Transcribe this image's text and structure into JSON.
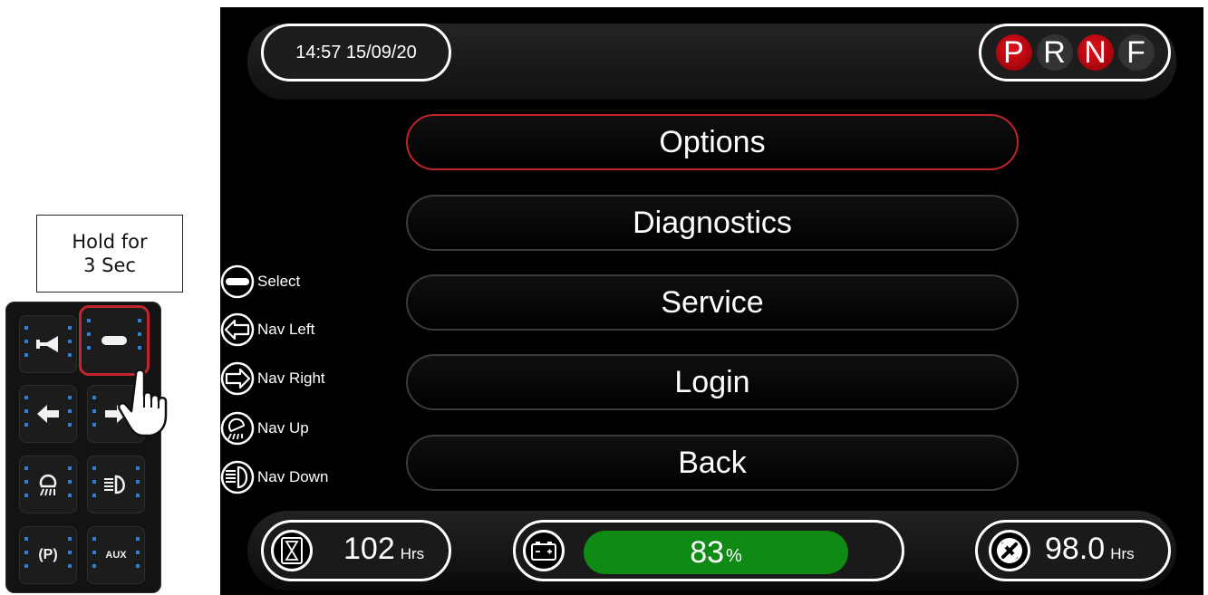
{
  "hint": {
    "line1": "Hold for",
    "line2": "3 Sec"
  },
  "keypad": {
    "aux_label": "AUX",
    "parking_label": "(P)",
    "selected_key": "select-key"
  },
  "header": {
    "datetime": "14:57 15/09/20",
    "gears": [
      {
        "label": "P",
        "active": true
      },
      {
        "label": "R",
        "active": false
      },
      {
        "label": "N",
        "active": true
      },
      {
        "label": "F",
        "active": false
      }
    ]
  },
  "menu": {
    "items": [
      "Options",
      "Diagnostics",
      "Service",
      "Login",
      "Back"
    ],
    "selected_index": 0
  },
  "legend": [
    {
      "icon": "select-icon",
      "label": "Select"
    },
    {
      "icon": "arrow-left-icon",
      "label": "Nav Left"
    },
    {
      "icon": "arrow-right-icon",
      "label": "Nav Right"
    },
    {
      "icon": "work-light-icon",
      "label": "Nav Up"
    },
    {
      "icon": "headlight-icon",
      "label": "Nav Down"
    }
  ],
  "status": {
    "hours_value": "102",
    "hours_unit": "Hrs",
    "battery_value": "83",
    "battery_unit": "%",
    "battery_level": 0.83,
    "service_value": "98.0",
    "service_unit": "Hrs"
  },
  "colors": {
    "accent_red": "#c2232a",
    "battery_green": "#0f8a14",
    "screen_bg": "#000000"
  }
}
